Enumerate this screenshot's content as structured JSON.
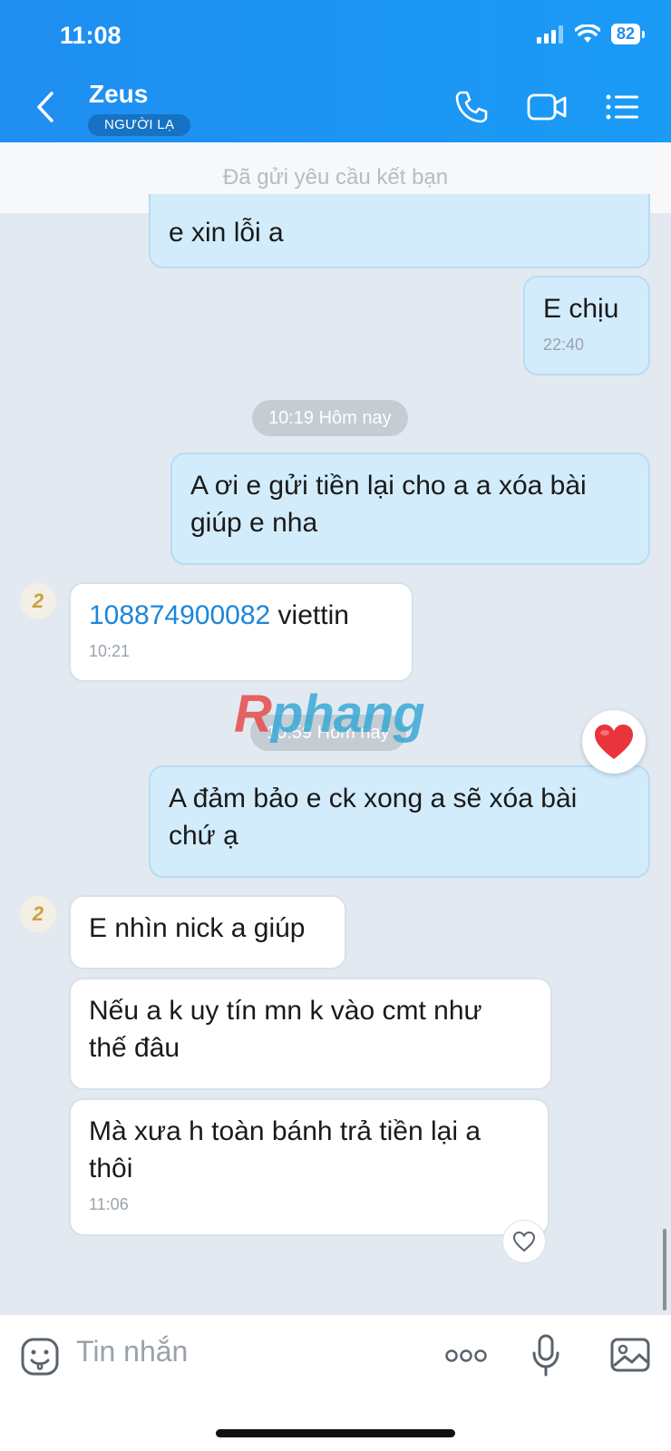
{
  "status_bar": {
    "time": "11:08",
    "battery": "82"
  },
  "header": {
    "contact_name": "Zeus",
    "badge": "NGƯỜI LẠ"
  },
  "banner": {
    "text": "Đã gửi yêu cầu kết bạn"
  },
  "messages": {
    "m1": {
      "text": "e xin lỗi a"
    },
    "m2": {
      "text": "E chịu",
      "time": "22:40"
    },
    "date1": "10:19 Hôm nay",
    "m3": {
      "line1": "A ơi e gửi tiền lại cho a a xóa bài",
      "line2": "giúp e nha"
    },
    "m4": {
      "number": "108874900082",
      "text": " viettin",
      "time": "10:21"
    },
    "date2": "10:59 Hôm nay",
    "m5": {
      "line1": "A đảm bảo e ck xong a sẽ xóa bài",
      "line2": "chứ ạ"
    },
    "m6": {
      "text": "E nhìn nick a giúp"
    },
    "m7": {
      "line1": "Nếu a k uy tín mn k vào cmt như",
      "line2": "thế đâu"
    },
    "m8": {
      "line1": "Mà xưa h toàn bánh trả tiền lại a",
      "line2": "thôi",
      "time": "11:06"
    }
  },
  "watermark": {
    "first": "R",
    "rest": "phang"
  },
  "input": {
    "placeholder": "Tin nhắn"
  },
  "colors": {
    "header": "#1f8ef1",
    "outgoing_bubble": "#d3ecfb",
    "incoming_bubble": "#ffffff",
    "chat_bg": "#e2e9f1"
  }
}
